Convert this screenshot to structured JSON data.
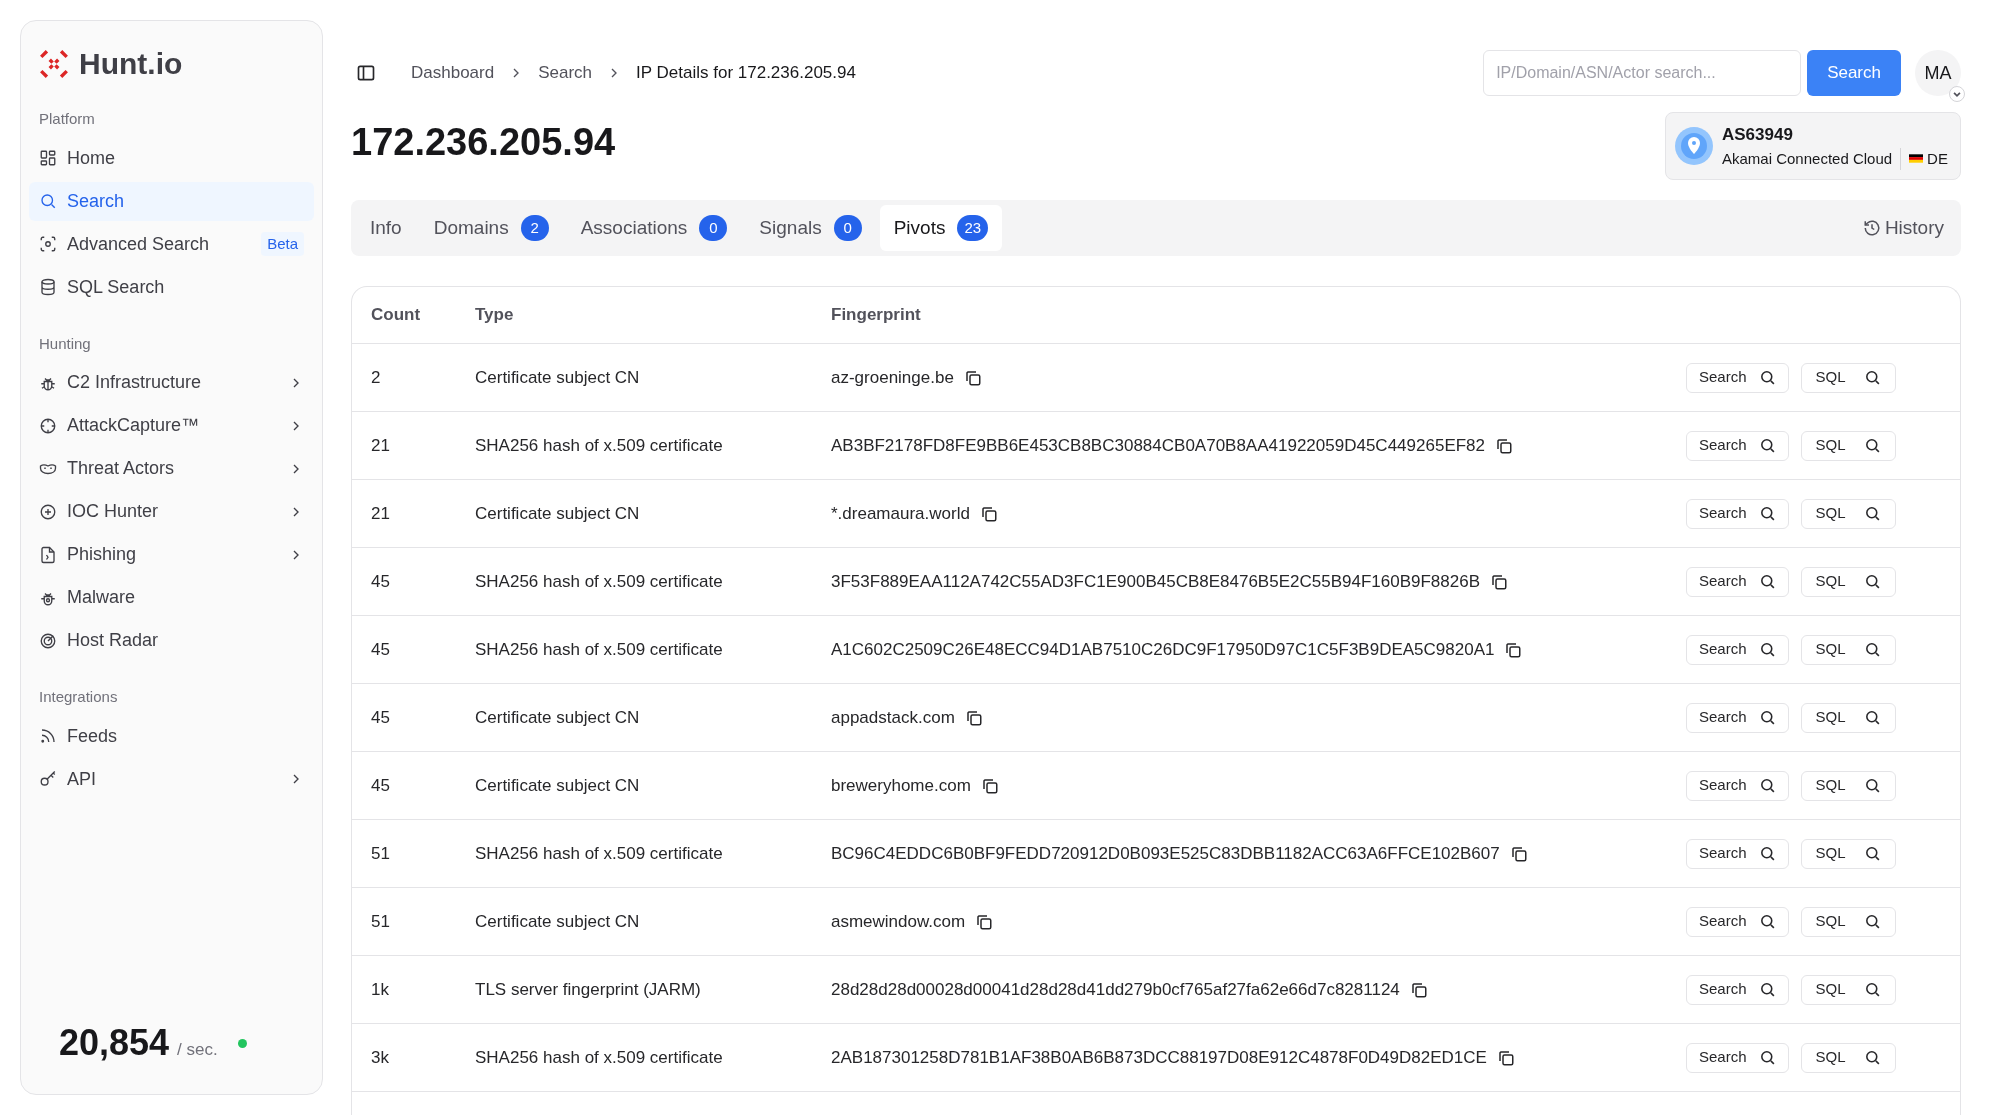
{
  "sidebar": {
    "logo": "Hunt.io",
    "sections": [
      {
        "heading": "Platform",
        "items": [
          {
            "label": "Home",
            "selected": false,
            "chevron": false
          },
          {
            "label": "Search",
            "selected": true,
            "chevron": false
          },
          {
            "label": "Advanced Search",
            "selected": false,
            "chevron": false,
            "badge": "Beta"
          },
          {
            "label": "SQL Search",
            "selected": false,
            "chevron": false
          }
        ]
      },
      {
        "heading": "Hunting",
        "items": [
          {
            "label": "C2 Infrastructure",
            "selected": false,
            "chevron": true
          },
          {
            "label": "AttackCapture™",
            "selected": false,
            "chevron": true
          },
          {
            "label": "Threat Actors",
            "selected": false,
            "chevron": true
          },
          {
            "label": "IOC Hunter",
            "selected": false,
            "chevron": true
          },
          {
            "label": "Phishing",
            "selected": false,
            "chevron": true
          },
          {
            "label": "Malware",
            "selected": false,
            "chevron": false
          },
          {
            "label": "Host Radar",
            "selected": false,
            "chevron": false
          }
        ]
      },
      {
        "heading": "Integrations",
        "items": [
          {
            "label": "Feeds",
            "selected": false,
            "chevron": false
          },
          {
            "label": "API",
            "selected": false,
            "chevron": true
          }
        ]
      }
    ],
    "rate": {
      "value": "20,854",
      "unit": "/ sec."
    }
  },
  "breadcrumb": [
    "Dashboard",
    "Search",
    "IP Details for 172.236.205.94"
  ],
  "search": {
    "placeholder": "IP/Domain/ASN/Actor search...",
    "button": "Search"
  },
  "avatar": "MA",
  "title": "172.236.205.94",
  "asn": {
    "number": "AS63949",
    "org": "Akamai Connected Cloud",
    "country": "DE"
  },
  "tabs": [
    {
      "label": "Info",
      "selected": false
    },
    {
      "label": "Domains",
      "count": "2",
      "selected": false
    },
    {
      "label": "Associations",
      "count": "0",
      "selected": false
    },
    {
      "label": "Signals",
      "count": "0",
      "selected": false
    },
    {
      "label": "Pivots",
      "count": "23",
      "selected": true
    }
  ],
  "history": "History",
  "table": {
    "columns": [
      "Count",
      "Type",
      "Fingerprint"
    ],
    "rows": [
      {
        "count": "2",
        "type": "Certificate subject CN",
        "fingerprint": "az-groeninge.be",
        "search_button": "Search",
        "sql_button": "SQL"
      },
      {
        "count": "21",
        "type": "SHA256 hash of x.509 certificate",
        "fingerprint": "AB3BF2178FD8FE9BB6E453CB8BC30884CB0A70B8AA41922059D45C449265EF82",
        "search_button": "Search",
        "sql_button": "SQL"
      },
      {
        "count": "21",
        "type": "Certificate subject CN",
        "fingerprint": "*.dreamaura.world",
        "search_button": "Search",
        "sql_button": "SQL"
      },
      {
        "count": "45",
        "type": "SHA256 hash of x.509 certificate",
        "fingerprint": "3F53F889EAA112A742C55AD3FC1E900B45CB8E8476B5E2C55B94F160B9F8826B",
        "search_button": "Search",
        "sql_button": "SQL"
      },
      {
        "count": "45",
        "type": "SHA256 hash of x.509 certificate",
        "fingerprint": "A1C602C2509C26E48ECC94D1AB7510C26DC9F17950D97C1C5F3B9DEA5C9820A1",
        "search_button": "Search",
        "sql_button": "SQL"
      },
      {
        "count": "45",
        "type": "Certificate subject CN",
        "fingerprint": "appadstack.com",
        "search_button": "Search",
        "sql_button": "SQL"
      },
      {
        "count": "45",
        "type": "Certificate subject CN",
        "fingerprint": "breweryhome.com",
        "search_button": "Search",
        "sql_button": "SQL"
      },
      {
        "count": "51",
        "type": "SHA256 hash of x.509 certificate",
        "fingerprint": "BC96C4EDDC6B0BF9FEDD720912D0B093E525C83DBB1182ACC63A6FFCE102B607",
        "search_button": "Search",
        "sql_button": "SQL"
      },
      {
        "count": "51",
        "type": "Certificate subject CN",
        "fingerprint": "asmewindow.com",
        "search_button": "Search",
        "sql_button": "SQL"
      },
      {
        "count": "1k",
        "type": "TLS server fingerprint (JARM)",
        "fingerprint": "28d28d28d00028d00041d28d28d41dd279b0cf765af27fa62e66d7c8281124",
        "search_button": "Search",
        "sql_button": "SQL"
      },
      {
        "count": "3k",
        "type": "SHA256 hash of x.509 certificate",
        "fingerprint": "2AB187301258D781B1AF38B0AB6B873DCC88197D08E912C4878F0D49D82ED1CE",
        "search_button": "Search",
        "sql_button": "SQL"
      }
    ]
  }
}
